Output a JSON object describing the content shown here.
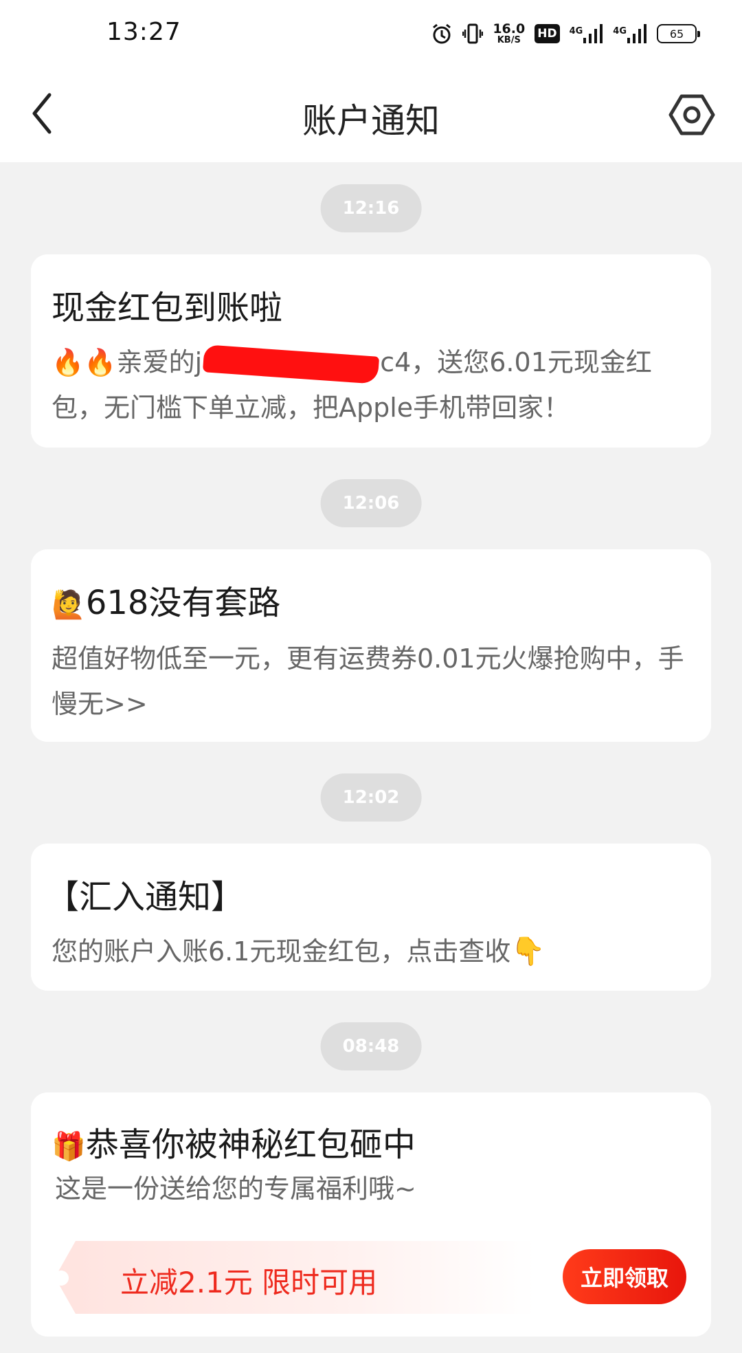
{
  "status_bar": {
    "time": "13:27",
    "net_speed_value": "16.0",
    "net_speed_unit": "KB/S",
    "hd_badge": "HD",
    "signal1_label": "4G",
    "signal2_label": "4G",
    "battery": "65",
    "icons": [
      "alarm-icon",
      "vibrate-icon",
      "signal-icon",
      "signal-icon",
      "battery-icon"
    ]
  },
  "header": {
    "title": "账户通知",
    "back_icon": "chevron-left-icon",
    "settings_icon": "settings-icon"
  },
  "messages": [
    {
      "time": "12:16",
      "title": "现金红包到账啦",
      "body_prefix": "🔥🔥亲爱的j",
      "body_suffix": "c4，送您6.01元现金红包，无门槛下单立减，把Apple手机带回家！"
    },
    {
      "time": "12:06",
      "title_emoji": "🙋",
      "title": "618没有套路",
      "body": "超值好物低至一元，更有运费券0.01元火爆抢购中，手慢无>>"
    },
    {
      "time": "12:02",
      "title": "【汇入通知】",
      "body": "您的账户入账6.1元现金红包，点击查收",
      "body_emoji": "👇"
    },
    {
      "time": "08:48",
      "title_emoji": "🎁",
      "title": "恭喜你被神秘红包砸中",
      "body": "这是一份送给您的专属福利哦~",
      "coupon_text": "立减2.1元 限时可用",
      "claim_button": "立即领取"
    }
  ],
  "colors": {
    "background": "#f2f2f2",
    "card": "#ffffff",
    "time_pill": "#dedede",
    "accent_red": "#ee2a1e"
  }
}
